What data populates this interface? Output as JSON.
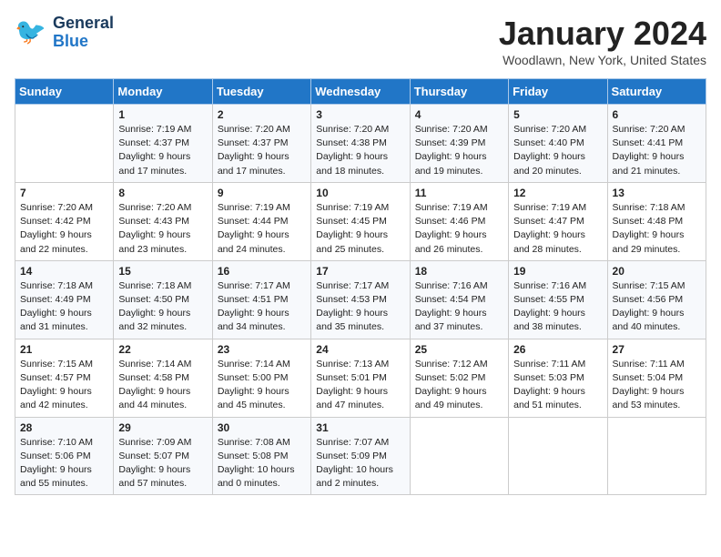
{
  "header": {
    "logo_line1": "General",
    "logo_line2": "Blue",
    "title": "January 2024",
    "subtitle": "Woodlawn, New York, United States"
  },
  "days_of_week": [
    "Sunday",
    "Monday",
    "Tuesday",
    "Wednesday",
    "Thursday",
    "Friday",
    "Saturday"
  ],
  "weeks": [
    [
      {
        "day": "",
        "lines": []
      },
      {
        "day": "1",
        "lines": [
          "Sunrise: 7:19 AM",
          "Sunset: 4:37 PM",
          "Daylight: 9 hours",
          "and 17 minutes."
        ]
      },
      {
        "day": "2",
        "lines": [
          "Sunrise: 7:20 AM",
          "Sunset: 4:37 PM",
          "Daylight: 9 hours",
          "and 17 minutes."
        ]
      },
      {
        "day": "3",
        "lines": [
          "Sunrise: 7:20 AM",
          "Sunset: 4:38 PM",
          "Daylight: 9 hours",
          "and 18 minutes."
        ]
      },
      {
        "day": "4",
        "lines": [
          "Sunrise: 7:20 AM",
          "Sunset: 4:39 PM",
          "Daylight: 9 hours",
          "and 19 minutes."
        ]
      },
      {
        "day": "5",
        "lines": [
          "Sunrise: 7:20 AM",
          "Sunset: 4:40 PM",
          "Daylight: 9 hours",
          "and 20 minutes."
        ]
      },
      {
        "day": "6",
        "lines": [
          "Sunrise: 7:20 AM",
          "Sunset: 4:41 PM",
          "Daylight: 9 hours",
          "and 21 minutes."
        ]
      }
    ],
    [
      {
        "day": "7",
        "lines": []
      },
      {
        "day": "8",
        "lines": [
          "Sunrise: 7:20 AM",
          "Sunset: 4:43 PM",
          "Daylight: 9 hours",
          "and 23 minutes."
        ]
      },
      {
        "day": "9",
        "lines": [
          "Sunrise: 7:19 AM",
          "Sunset: 4:44 PM",
          "Daylight: 9 hours",
          "and 24 minutes."
        ]
      },
      {
        "day": "10",
        "lines": [
          "Sunrise: 7:19 AM",
          "Sunset: 4:45 PM",
          "Daylight: 9 hours",
          "and 25 minutes."
        ]
      },
      {
        "day": "11",
        "lines": [
          "Sunrise: 7:19 AM",
          "Sunset: 4:46 PM",
          "Daylight: 9 hours",
          "and 26 minutes."
        ]
      },
      {
        "day": "12",
        "lines": [
          "Sunrise: 7:19 AM",
          "Sunset: 4:47 PM",
          "Daylight: 9 hours",
          "and 28 minutes."
        ]
      },
      {
        "day": "13",
        "lines": [
          "Sunrise: 7:18 AM",
          "Sunset: 4:48 PM",
          "Daylight: 9 hours",
          "and 29 minutes."
        ]
      }
    ],
    [
      {
        "day": "14",
        "lines": []
      },
      {
        "day": "15",
        "lines": [
          "Sunrise: 7:18 AM",
          "Sunset: 4:50 PM",
          "Daylight: 9 hours",
          "and 32 minutes."
        ]
      },
      {
        "day": "16",
        "lines": [
          "Sunrise: 7:17 AM",
          "Sunset: 4:51 PM",
          "Daylight: 9 hours",
          "and 34 minutes."
        ]
      },
      {
        "day": "17",
        "lines": [
          "Sunrise: 7:17 AM",
          "Sunset: 4:53 PM",
          "Daylight: 9 hours",
          "and 35 minutes."
        ]
      },
      {
        "day": "18",
        "lines": [
          "Sunrise: 7:16 AM",
          "Sunset: 4:54 PM",
          "Daylight: 9 hours",
          "and 37 minutes."
        ]
      },
      {
        "day": "19",
        "lines": [
          "Sunrise: 7:16 AM",
          "Sunset: 4:55 PM",
          "Daylight: 9 hours",
          "and 38 minutes."
        ]
      },
      {
        "day": "20",
        "lines": [
          "Sunrise: 7:15 AM",
          "Sunset: 4:56 PM",
          "Daylight: 9 hours",
          "and 40 minutes."
        ]
      }
    ],
    [
      {
        "day": "21",
        "lines": []
      },
      {
        "day": "22",
        "lines": [
          "Sunrise: 7:14 AM",
          "Sunset: 4:58 PM",
          "Daylight: 9 hours",
          "and 44 minutes."
        ]
      },
      {
        "day": "23",
        "lines": [
          "Sunrise: 7:14 AM",
          "Sunset: 5:00 PM",
          "Daylight: 9 hours",
          "and 45 minutes."
        ]
      },
      {
        "day": "24",
        "lines": [
          "Sunrise: 7:13 AM",
          "Sunset: 5:01 PM",
          "Daylight: 9 hours",
          "and 47 minutes."
        ]
      },
      {
        "day": "25",
        "lines": [
          "Sunrise: 7:12 AM",
          "Sunset: 5:02 PM",
          "Daylight: 9 hours",
          "and 49 minutes."
        ]
      },
      {
        "day": "26",
        "lines": [
          "Sunrise: 7:11 AM",
          "Sunset: 5:03 PM",
          "Daylight: 9 hours",
          "and 51 minutes."
        ]
      },
      {
        "day": "27",
        "lines": [
          "Sunrise: 7:11 AM",
          "Sunset: 5:04 PM",
          "Daylight: 9 hours",
          "and 53 minutes."
        ]
      }
    ],
    [
      {
        "day": "28",
        "lines": [
          "Sunrise: 7:10 AM",
          "Sunset: 5:06 PM",
          "Daylight: 9 hours",
          "and 55 minutes."
        ]
      },
      {
        "day": "29",
        "lines": [
          "Sunrise: 7:09 AM",
          "Sunset: 5:07 PM",
          "Daylight: 9 hours",
          "and 57 minutes."
        ]
      },
      {
        "day": "30",
        "lines": [
          "Sunrise: 7:08 AM",
          "Sunset: 5:08 PM",
          "Daylight: 10 hours",
          "and 0 minutes."
        ]
      },
      {
        "day": "31",
        "lines": [
          "Sunrise: 7:07 AM",
          "Sunset: 5:09 PM",
          "Daylight: 10 hours",
          "and 2 minutes."
        ]
      },
      {
        "day": "",
        "lines": []
      },
      {
        "day": "",
        "lines": []
      },
      {
        "day": "",
        "lines": []
      }
    ]
  ],
  "week7_sun": {
    "day": "7",
    "lines": [
      "Sunrise: 7:20 AM",
      "Sunset: 4:42 PM",
      "Daylight: 9 hours",
      "and 22 minutes."
    ]
  },
  "week14_sun": {
    "day": "14",
    "lines": [
      "Sunrise: 7:18 AM",
      "Sunset: 4:49 PM",
      "Daylight: 9 hours",
      "and 31 minutes."
    ]
  },
  "week21_sun": {
    "day": "21",
    "lines": [
      "Sunrise: 7:15 AM",
      "Sunset: 4:57 PM",
      "Daylight: 9 hours",
      "and 42 minutes."
    ]
  }
}
